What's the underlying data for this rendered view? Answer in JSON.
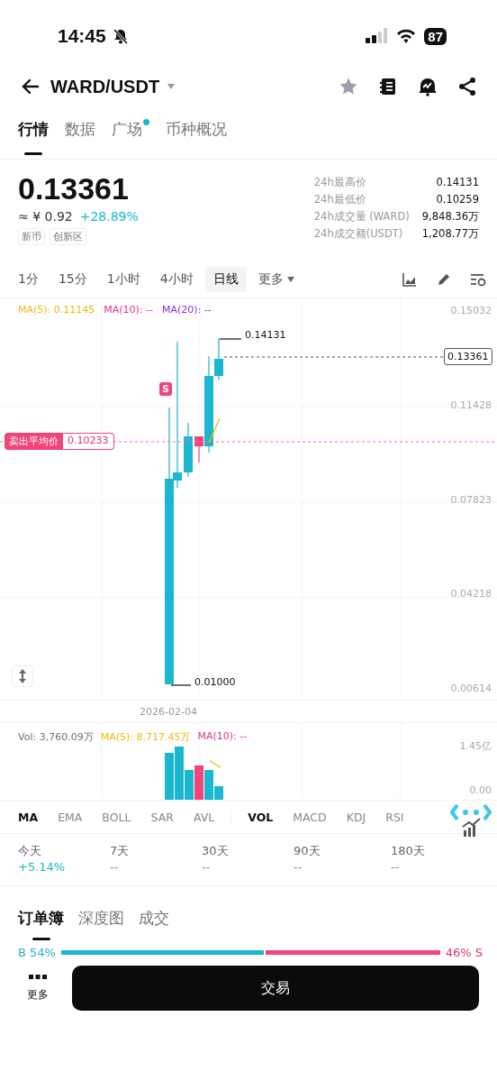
{
  "status_bar": {
    "time": "14:45",
    "battery": "87"
  },
  "header": {
    "pair": "WARD/USDT"
  },
  "tabs": [
    {
      "label": "行情",
      "selected": true,
      "dot": false
    },
    {
      "label": "数据",
      "selected": false,
      "dot": false
    },
    {
      "label": "广场",
      "selected": false,
      "dot": true
    },
    {
      "label": "币种概况",
      "selected": false,
      "dot": false
    }
  ],
  "quote": {
    "last": "0.13361",
    "cny": "≈ ¥ 0.92",
    "change": "+28.89%",
    "tags": [
      "新币",
      "创新区"
    ]
  },
  "stats": [
    {
      "label": "24h最高价",
      "value": "0.14131"
    },
    {
      "label": "24h最低价",
      "value": "0.10259"
    },
    {
      "label": "24h成交量 (WARD)",
      "value": "9,848.36万"
    },
    {
      "label": "24h成交额(USDT)",
      "value": "1,208.77万"
    }
  ],
  "timeframes": [
    {
      "label": "1分",
      "selected": false
    },
    {
      "label": "15分",
      "selected": false
    },
    {
      "label": "1小时",
      "selected": false
    },
    {
      "label": "4小时",
      "selected": false
    },
    {
      "label": "日线",
      "selected": true
    }
  ],
  "timeframe_more": "更多",
  "chart": {
    "ma_legend": [
      {
        "label": "MA(5): 0.11145",
        "color": "#f0b90b"
      },
      {
        "label": "MA(10): --",
        "color": "#e0338a"
      },
      {
        "label": "MA(20): --",
        "color": "#8a2be2"
      }
    ],
    "y_labels": [
      "0.15032",
      "0.11428",
      "0.07823",
      "0.04218",
      "0.00614"
    ],
    "marker": "S",
    "high_label": "0.14131",
    "low_label": "0.01000",
    "last_price_label": "0.13361",
    "sell_avg": {
      "label": "卖出平均价",
      "value": "0.10233"
    },
    "date": "2026-02-04"
  },
  "volume": {
    "legend": [
      {
        "label": "Vol: 3,760.09万",
        "color": "#6b7280"
      },
      {
        "label": "MA(5): 8,717.45万",
        "color": "#f0b90b"
      },
      {
        "label": "MA(10): --",
        "color": "#e0338a"
      }
    ],
    "y_labels": [
      "1.45亿",
      "0.00"
    ]
  },
  "main_indicators": [
    {
      "label": "MA",
      "selected": true
    },
    {
      "label": "EMA",
      "selected": false
    },
    {
      "label": "BOLL",
      "selected": false
    },
    {
      "label": "SAR",
      "selected": false
    },
    {
      "label": "AVL",
      "selected": false
    }
  ],
  "sub_indicators": [
    {
      "label": "VOL",
      "selected": true
    },
    {
      "label": "MACD",
      "selected": false
    },
    {
      "label": "KDJ",
      "selected": false
    },
    {
      "label": "RSI",
      "selected": false
    }
  ],
  "performance": [
    {
      "period": "今天",
      "value": "+5.14%",
      "color": "#1bb6cf"
    },
    {
      "period": "7天",
      "value": "--",
      "color": "#8a8f99"
    },
    {
      "period": "30天",
      "value": "--",
      "color": "#8a8f99"
    },
    {
      "period": "90天",
      "value": "--",
      "color": "#8a8f99"
    },
    {
      "period": "180天",
      "value": "--",
      "color": "#8a8f99"
    }
  ],
  "order_tabs": [
    {
      "label": "订单簿",
      "selected": true
    },
    {
      "label": "深度图",
      "selected": false
    },
    {
      "label": "成交",
      "selected": false
    }
  ],
  "ratio": {
    "buy_label": "B 54%",
    "sell_label": "46% S",
    "level": 0.54
  },
  "bottom": {
    "more": "更多",
    "trade": "交易"
  }
}
